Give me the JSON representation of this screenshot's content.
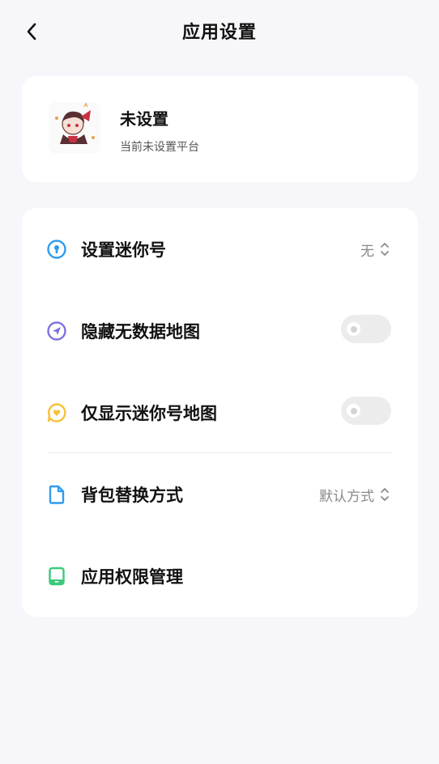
{
  "header": {
    "title": "应用设置"
  },
  "profile": {
    "name": "未设置",
    "subtitle": "当前未设置平台"
  },
  "settings": {
    "items": [
      {
        "label": "设置迷你号",
        "value": "无",
        "icon": "keyhole-icon",
        "icon_color": "#2e9cf0"
      },
      {
        "label": "隐藏无数据地图",
        "toggle": false,
        "icon": "send-icon",
        "icon_color": "#7c72e0"
      },
      {
        "label": "仅显示迷你号地图",
        "toggle": false,
        "icon": "heart-bubble-icon",
        "icon_color": "#f5c23a"
      },
      {
        "label": "背包替换方式",
        "value": "默认方式",
        "icon": "document-icon",
        "icon_color": "#2e9cf0"
      },
      {
        "label": "应用权限管理",
        "icon": "tablet-icon",
        "icon_color": "#3cc97a"
      }
    ]
  }
}
